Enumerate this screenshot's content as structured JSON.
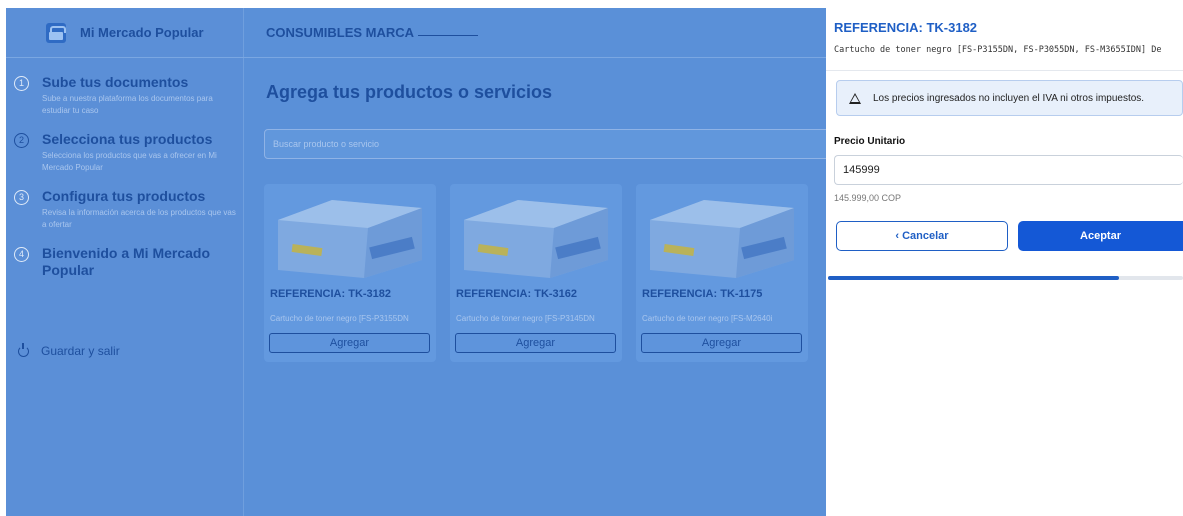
{
  "brand": {
    "title": "Mi Mercado Popular"
  },
  "steps": [
    {
      "num": "1",
      "title": "Sube tus documentos",
      "desc": "Sube a nuestra plataforma los documentos para estudiar tu caso"
    },
    {
      "num": "2",
      "title": "Selecciona tus productos",
      "desc": "Selecciona los productos que vas a ofrecer en Mi Mercado Popular"
    },
    {
      "num": "3",
      "title": "Configura tus productos",
      "desc": "Revisa la información acerca de los productos que vas a ofertar"
    },
    {
      "num": "4",
      "title": "Bienvenido a Mi Mercado Popular",
      "desc": ""
    }
  ],
  "save_label": "Guardar y salir",
  "header": {
    "breadcrumb": "CONSUMIBLES MARCA"
  },
  "main": {
    "title": "Agrega tus productos o servicios",
    "search_placeholder": "Buscar producto o servicio"
  },
  "products": [
    {
      "ref": "REFERENCIA: TK-3182",
      "desc": "Cartucho de toner negro [FS-P3155DN",
      "button": "Agregar"
    },
    {
      "ref": "REFERENCIA: TK-3162",
      "desc": "Cartucho de toner negro [FS-P3145DN",
      "button": "Agregar"
    },
    {
      "ref": "REFERENCIA: TK-1175",
      "desc": "Cartucho de toner negro [FS-M2640i",
      "button": "Agregar"
    }
  ],
  "panel": {
    "title": "REFERENCIA: TK-3182",
    "desc": "Cartucho de toner negro [FS-P3155DN, FS-P3055DN, FS-M3655IDN] De",
    "alert": "Los precios ingresados no incluyen el IVA ni otros impuestos.",
    "price_label": "Precio Unitario",
    "price_value": "145999",
    "price_hint": "145.999,00 COP",
    "cancel": "‹  Cancelar",
    "accept": "Aceptar",
    "progress": 0.82
  },
  "colors": {
    "accent": "#1458d6",
    "overlay": "#5a90d8",
    "brand_text": "#1e4f9e"
  }
}
